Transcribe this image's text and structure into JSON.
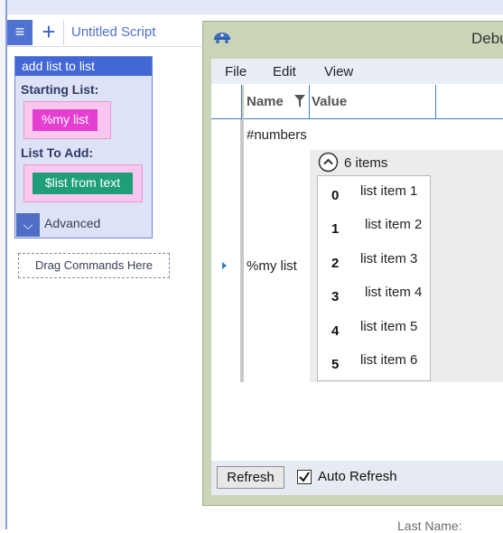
{
  "editor": {
    "tab_title": "Untitled Script",
    "menu_glyph": "≡",
    "add_glyph": "+",
    "command": {
      "header": "add list to list",
      "param1_label": "Starting List:",
      "param1_value": "%my list",
      "param2_label": "List To Add:",
      "param2_value": "$list from text",
      "advanced_label": "Advanced",
      "advanced_glyph": "⌵"
    },
    "drag_placeholder": "Drag Commands Here",
    "background_field_label": "Last Name:"
  },
  "debug_window": {
    "title": "Debu",
    "menu": [
      "File",
      "Edit",
      "View"
    ],
    "columns": {
      "name": "Name",
      "value": "Value"
    },
    "rows": [
      {
        "name": "#numbers"
      },
      {
        "name": "%my list",
        "summary": "6 items"
      }
    ],
    "list_items": [
      {
        "index": "0",
        "value": "list item 1"
      },
      {
        "index": "1",
        "value": "list item 2"
      },
      {
        "index": "2",
        "value": "list item 3"
      },
      {
        "index": "3",
        "value": "list item 4"
      },
      {
        "index": "4",
        "value": "list item 5"
      },
      {
        "index": "5",
        "value": "list item 6"
      }
    ],
    "refresh_label": "Refresh",
    "auto_refresh_label": "Auto Refresh",
    "auto_refresh_checked": true
  },
  "colors": {
    "accent_blue": "#4368d6",
    "variable_pink": "#e43fd0",
    "function_green": "#1f9e79",
    "window_frame": "#c9d5b6"
  }
}
